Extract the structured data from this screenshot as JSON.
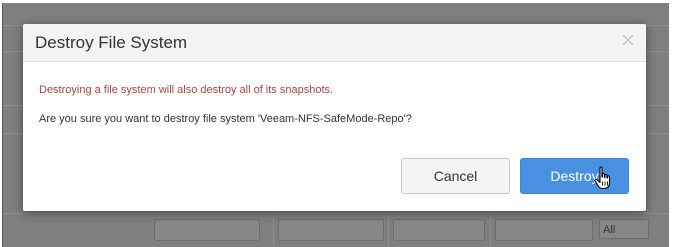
{
  "background": {
    "filter_value": "All"
  },
  "modal": {
    "title": "Destroy File System",
    "warning": "Destroying a file system will also destroy all of its snapshots.",
    "confirm": "Are you sure you want to destroy file system 'Veeam-NFS-SafeMode-Repo'?",
    "close_icon": "close-icon",
    "cancel_label": "Cancel",
    "destroy_label": "Destroy"
  },
  "colors": {
    "warning_text": "#a94442",
    "primary_button": "#4a90e2",
    "overlay": "#7f7f7f"
  },
  "cursor": "hand-pointer-icon"
}
